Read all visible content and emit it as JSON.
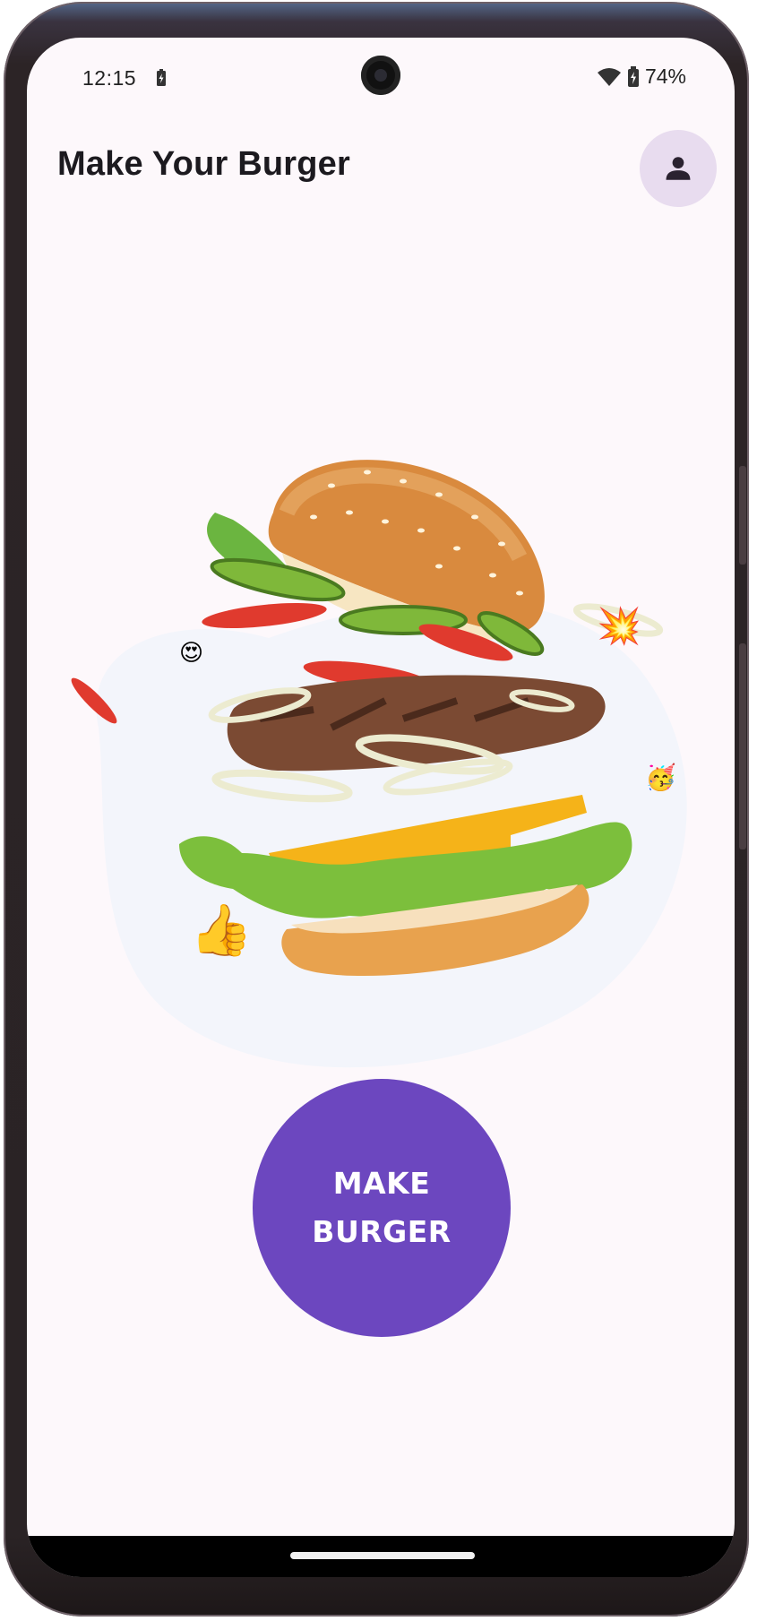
{
  "status_bar": {
    "time": "12:15",
    "battery_percent": "74%",
    "icons": [
      "battery-charging-icon",
      "wifi-icon",
      "battery-icon"
    ]
  },
  "app_bar": {
    "title": "Make Your Burger",
    "profile_icon": "person-icon"
  },
  "hero": {
    "image": "exploded-burger-illustration",
    "emojis": [
      "heart-eyes-emoji",
      "party-face-emoji",
      "thumbs-up-emoji",
      "collision-emoji"
    ]
  },
  "action": {
    "line1": "MAKE",
    "line2": "BURGER"
  },
  "colors": {
    "background": "#fdf8fb",
    "accent": "#6c47bf",
    "profile_bg": "#e8dcef",
    "title": "#1c1a1f"
  }
}
